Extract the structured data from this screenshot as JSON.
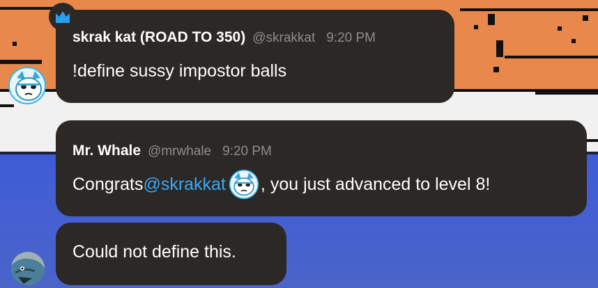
{
  "messages": [
    {
      "author": "skrak kat (ROAD TO 350)",
      "handle": "@skrakkat",
      "time": "9:20 PM",
      "text": "!define sussy impostor balls",
      "avatar_icon": "cat-avatar-icon",
      "badge_icon": "crown-icon"
    },
    {
      "author": "Mr. Whale",
      "handle": "@mrwhale",
      "time": "9:20 PM",
      "text_before": "Congrats ",
      "mention": "@skrakkat",
      "inline_icon": "cat-emoji-icon",
      "text_after": ", you just advanced to level 8!"
    },
    {
      "text": "Could not define this.",
      "avatar_icon": "whale-avatar-icon"
    }
  ],
  "colors": {
    "bubble": "#2b2826",
    "mention": "#3fa7f5",
    "muted": "#8f8c89",
    "crown": "#2a9ef0",
    "bg_orange": "#e9884b",
    "bg_blue": "#3e5cd6"
  }
}
